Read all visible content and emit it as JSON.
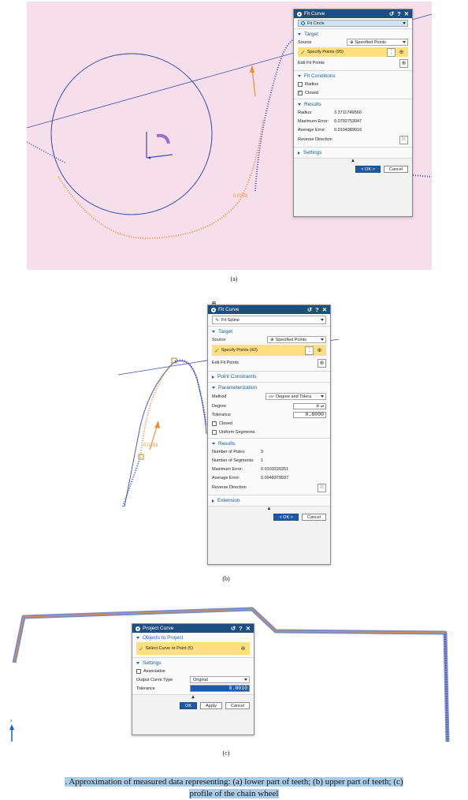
{
  "panel_a": {
    "dialog": {
      "title": "Fit Curve",
      "controls": {
        "reset": "↺",
        "help": "?",
        "close": "✕"
      },
      "type_value": "Fit Circle",
      "target": {
        "header": "Target",
        "source_label": "Source",
        "source_value": "Specified Points",
        "specify_points": "Specify Points (95)",
        "edit_fit_points": "Edit Fit Points"
      },
      "fit_conditions": {
        "header": "Fit Conditions",
        "radius": "Radius",
        "closed": "Closed",
        "closed_checked": true
      },
      "results": {
        "header": "Results",
        "radius_label": "Radius:",
        "radius_value": "3.3711749560",
        "max_error_label": "Maximum Error:",
        "max_error_value": "0.0702753047",
        "avg_error_label": "Average Error:",
        "avg_error_value": "0.0104389016",
        "reverse_direction": "Reverse Direction"
      },
      "settings_header": "Settings",
      "ok": "< OK >",
      "cancel": "Cancel"
    },
    "point_label": "0.0703",
    "caption": "(a)"
  },
  "panel_b": {
    "dialog": {
      "title": "Fit Curve",
      "controls": {
        "reset": "↺",
        "help": "?",
        "close": "✕"
      },
      "type_value": "Fit Spline",
      "target": {
        "header": "Target",
        "source_label": "Source",
        "source_value": "Specified Points",
        "specify_points": "Specify Points (42)",
        "edit_fit_points": "Edit Fit Points"
      },
      "point_constraints_header": "Point Constraints",
      "parameterization": {
        "header": "Parameterization",
        "method_label": "Method",
        "method_value": "Degree and Tolera",
        "degree_label": "Degree",
        "degree_value": "8",
        "tolerance_label": "Tolerance",
        "tolerance_value": "0.8000",
        "closed": "Closed",
        "uniform_segments": "Uniform Segments"
      },
      "results": {
        "header": "Results",
        "poles_label": "Number of Poles:",
        "poles_value": "9",
        "segments_label": "Number of Segments:",
        "segments_value": "1",
        "max_error_label": "Maximum Error:",
        "max_error_value": "0.0103220251",
        "avg_error_label": "Average Error:",
        "avg_error_value": "0.0048379597",
        "reverse_direction": "Reverse Direction"
      },
      "extension_header": "Extension",
      "ok": "< OK >",
      "cancel": "Cancel"
    },
    "point_label": "0.0103",
    "caption": "(b)"
  },
  "panel_c": {
    "dialog": {
      "title": "Project Curve",
      "controls": {
        "reset": "↺",
        "help": "?",
        "close": "✕"
      },
      "objects_header": "Objects to Project",
      "select_curve": "Select Curve or Point (5)",
      "settings_header": "Settings",
      "associative": "Associative",
      "output_type_label": "Output Curve Type",
      "output_type_value": "Original",
      "tolerance_label": "Tolerance",
      "tolerance_value": "0.0010",
      "ok": "OK",
      "apply": "Apply",
      "cancel": "Cancel"
    },
    "axis_label": "z",
    "caption": "(c)"
  },
  "figure_caption_line1": ". Approximation of measured data representing: (a) lower part of teeth; (b) upper part of teeth; (c)",
  "figure_caption_line2": "profile of the chain wheel",
  "colors": {
    "background_a": "#f6dfea",
    "curve_blue": "#3a4fb4",
    "points_orange": "#e8903a",
    "title_bar": "#1d4e80",
    "highlight": "#fddf7e",
    "caption_highlight": "#a9cce8"
  }
}
